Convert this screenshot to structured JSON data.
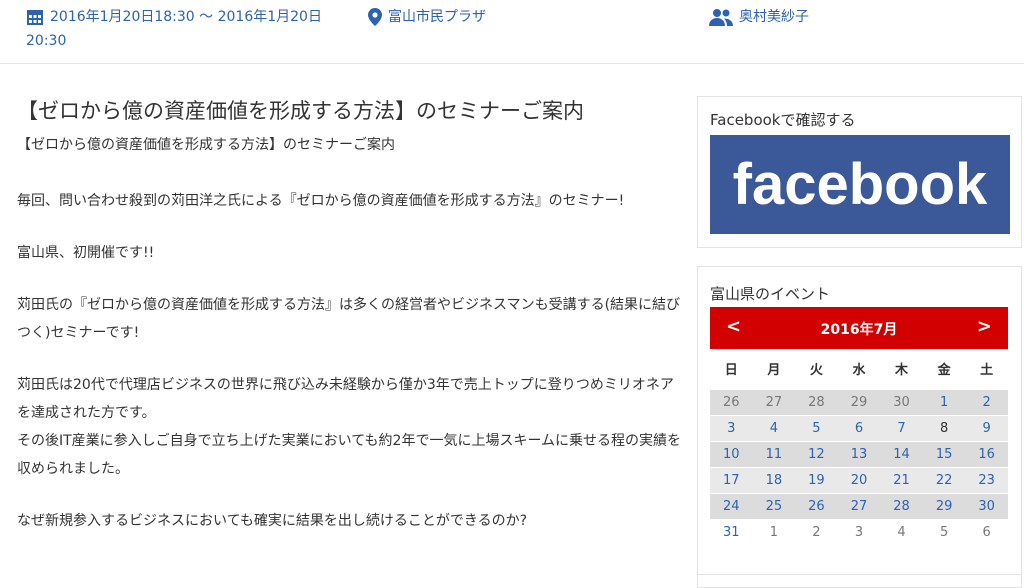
{
  "event_meta": {
    "date_line1": "2016年1月20日18:30 〜 2016年1月20日",
    "date_line2": "20:30",
    "place": "富山市民プラザ",
    "person": "奥村美紗子",
    "date_icon": "calendar-icon",
    "place_icon": "map-pin-icon",
    "person_icon": "users-icon"
  },
  "post": {
    "title": "【ゼロから億の資産価値を形成する方法】のセミナーご案内",
    "subtitle": "【ゼロから億の資産価値を形成する方法】のセミナーご案内",
    "paragraphs": [
      "毎回、問い合わせ殺到の苅田洋之氏による『ゼロから億の資産価値を形成する方法』のセミナー!",
      "富山県、初開催です!!",
      "苅田氏の『ゼロから億の資産価値を形成する方法』は多くの経営者やビジネスマンも受講する(結果に結びつく)セミナーです!",
      "苅田氏は20代で代理店ビジネスの世界に飛び込み未経験から僅か3年で売上トップに登りつめミリオネアを達成された方です。",
      "その後IT産業に参入しご自身で立ち上げた実業においても約2年で一気に上場スキームに乗せる程の実績を収められました。",
      "なぜ新規参入するビジネスにおいても確実に結果を出し続けることができるのか?"
    ]
  },
  "sidebar": {
    "facebook_title": "Facebookで確認する",
    "facebook_logo_text": "facebook",
    "facebook_color": "#3b5998",
    "events_title": "富山県のイベント"
  },
  "calendar": {
    "month_label": "2016年7月",
    "prev_label": "<",
    "next_label": ">",
    "header_color": "#d30000",
    "weekdays": [
      "日",
      "月",
      "火",
      "水",
      "木",
      "金",
      "土"
    ],
    "weeks": [
      [
        "26",
        "27",
        "28",
        "29",
        "30",
        "1",
        "2"
      ],
      [
        "3",
        "4",
        "5",
        "6",
        "7",
        "8",
        "9"
      ],
      [
        "10",
        "11",
        "12",
        "13",
        "14",
        "15",
        "16"
      ],
      [
        "17",
        "18",
        "19",
        "20",
        "21",
        "22",
        "23"
      ],
      [
        "24",
        "25",
        "26",
        "27",
        "28",
        "29",
        "30"
      ],
      [
        "31",
        "1",
        "2",
        "3",
        "4",
        "5",
        "6"
      ]
    ]
  }
}
